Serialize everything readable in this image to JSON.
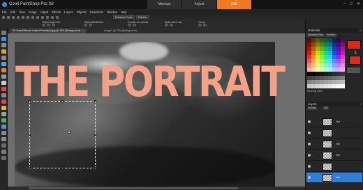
{
  "app": {
    "title": "Corel PaintShop Pro X8",
    "workspace_tabs": [
      {
        "label": "Manage",
        "active": false
      },
      {
        "label": "Adjust",
        "active": false
      },
      {
        "label": "Edit",
        "active": true
      }
    ],
    "accent_color": "#f07a22"
  },
  "window_controls": {
    "minimize": "–",
    "maximize": "□",
    "close": "✕"
  },
  "menu": [
    "File",
    "Edit",
    "View",
    "Image",
    "Adjust",
    "Effects",
    "Layers",
    "Objects",
    "Selections",
    "Window",
    "Help"
  ],
  "toolbar": {
    "dropdowns": [
      "Enhance Photo",
      "Palettes"
    ]
  },
  "options_bar": {
    "labels": [
      "Object alignment",
      "Object distribution",
      "Position on canvas",
      "Make same size",
      "Group"
    ]
  },
  "document_tabs": [
    {
      "label": "37-Jean-Etienne-Liotard-Portrait(1).jpg @ 15% (Background)",
      "active": true
    },
    {
      "label": "Image1 @ 75% (Background)",
      "active": false
    }
  ],
  "canvas": {
    "headline": "THE PORTRAIT",
    "headline_color": "#f4a287"
  },
  "materials": {
    "title": "Materials",
    "tabs": [
      "Standard/Photo",
      "Rainbow"
    ],
    "foreground_color": "#e02814",
    "background_color": "#e22a12",
    "recent_label": "Recently Used"
  },
  "layers": {
    "title": "Layers",
    "blend_mode": "Normal",
    "opacity": "100",
    "items": [
      {
        "name": "Text",
        "selected": false
      },
      {
        "name": "",
        "selected": false
      },
      {
        "name": "Text",
        "selected": false
      },
      {
        "name": "Text",
        "selected": false
      },
      {
        "name": "",
        "selected": false
      },
      {
        "name": "Text",
        "selected": true
      }
    ]
  }
}
